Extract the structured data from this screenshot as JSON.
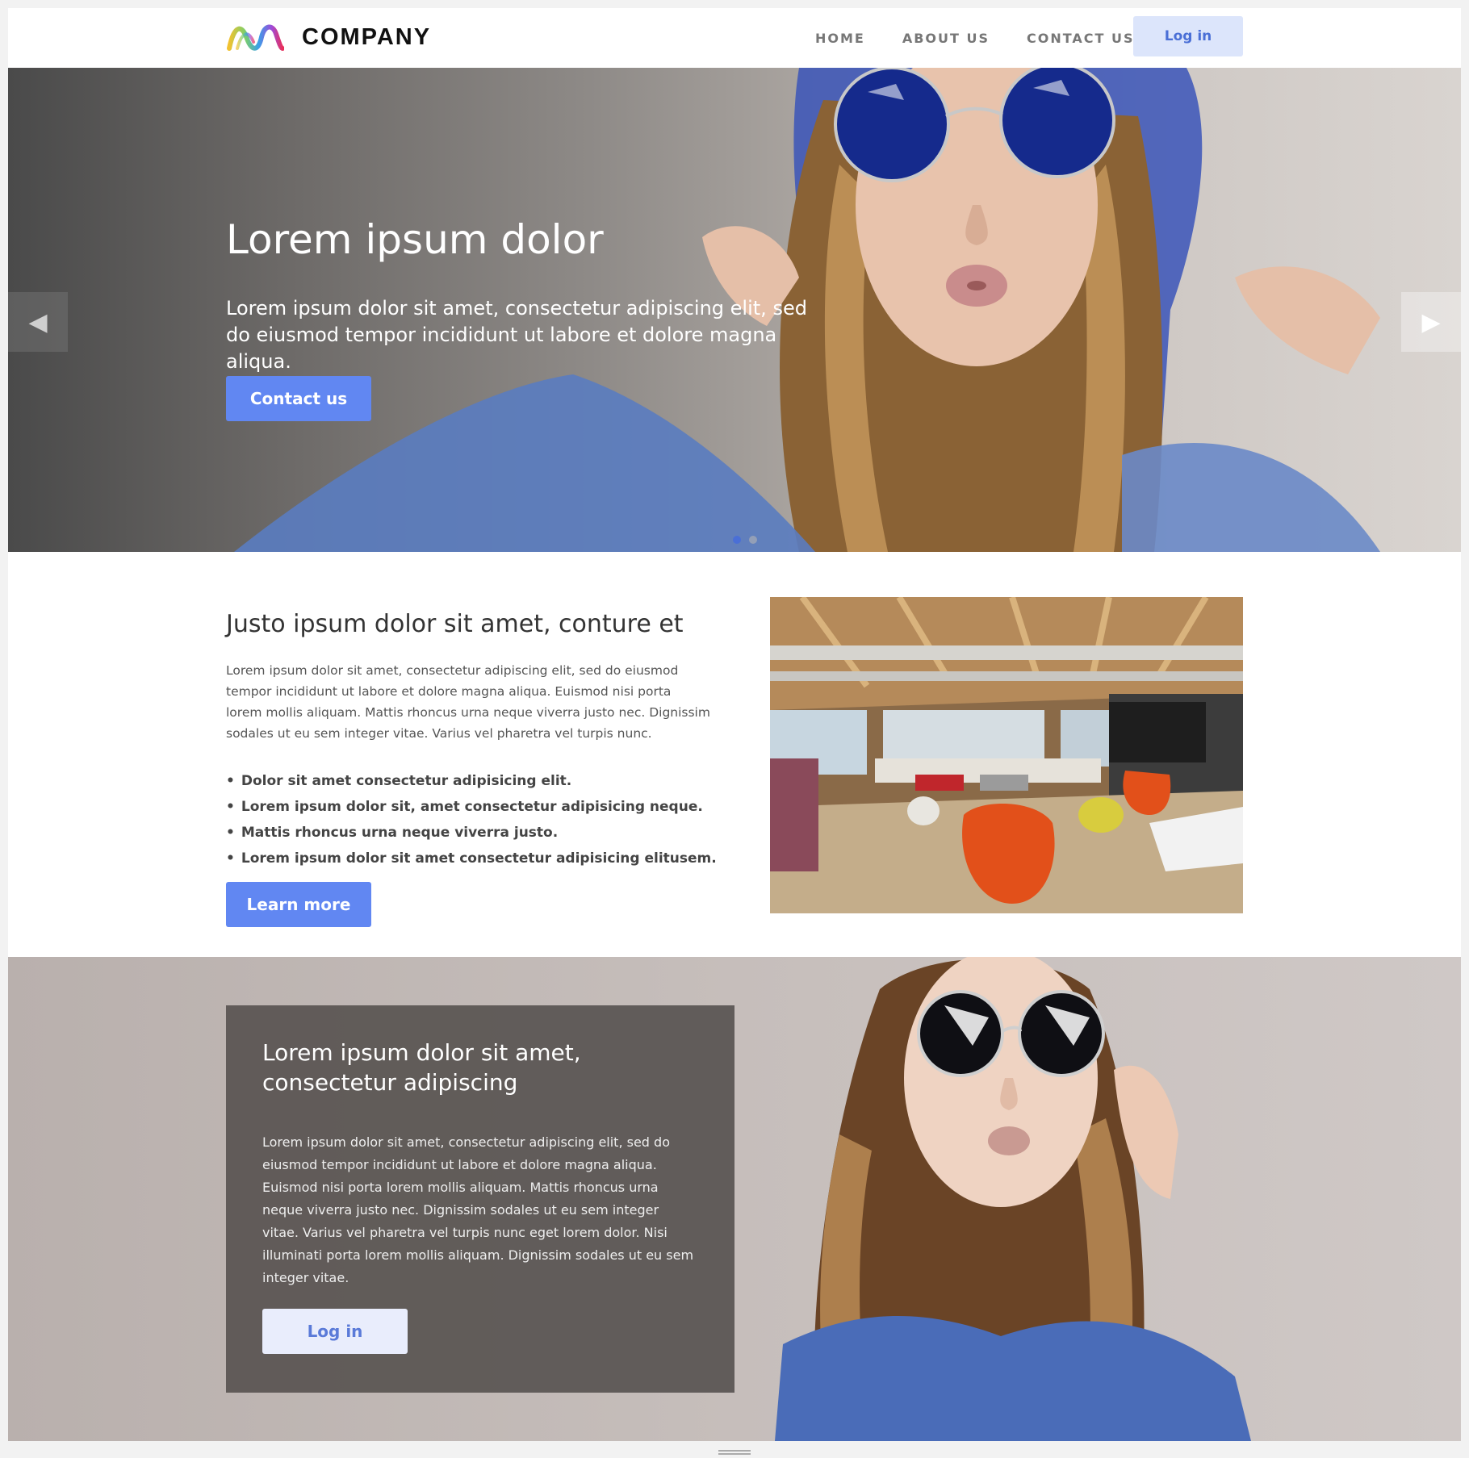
{
  "header": {
    "logo_text": "COMPANY",
    "nav": [
      "HOME",
      "ABOUT US",
      "CONTACT US"
    ],
    "login": "Log in"
  },
  "hero": {
    "title": "Lorem ipsum dolor",
    "subtitle": "Lorem ipsum dolor sit amet, consectetur adipiscing elit, sed do eiusmod tempor incididunt ut labore et dolore magna aliqua.",
    "button": "Contact us",
    "prev_icon": "chevron-left-icon",
    "next_icon": "chevron-right-icon"
  },
  "feature": {
    "title": "Justo ipsum dolor sit amet, conture et",
    "text": "Lorem ipsum dolor sit amet, consectetur adipiscing elit, sed do eiusmod tempor incididunt ut labore et dolore magna aliqua. Euismod nisi porta lorem mollis aliquam. Mattis rhoncus urna neque viverra justo nec. Dignissim sodales ut eu sem integer vitae. Varius vel pharetra vel turpis nunc.",
    "bullets": [
      "Dolor sit amet consectetur adipisicing elit.",
      "Lorem ipsum dolor sit, amet consectetur adipisicing neque.",
      "Mattis rhoncus urna neque viverra justo.",
      "Lorem ipsum dolor sit amet consectetur adipisicing elitusem."
    ],
    "button": "Learn more"
  },
  "promo": {
    "title": "Lorem ipsum dolor sit amet, consectetur adipiscing",
    "text": "Lorem ipsum dolor sit amet, consectetur adipiscing elit, sed do eiusmod tempor incididunt ut labore et dolore magna aliqua. Euismod nisi porta lorem mollis aliquam. Mattis rhoncus urna neque viverra justo nec. Dignissim sodales ut eu sem integer vitae. Varius vel pharetra vel turpis nunc eget lorem dolor. Nisi illuminati porta lorem mollis aliquam. Dignissim sodales ut eu sem integer vitae.",
    "button": "Log in"
  },
  "colors": {
    "accent": "#6187f2",
    "login_bg": "#dce5fb",
    "card_bg": "#5c5654"
  }
}
